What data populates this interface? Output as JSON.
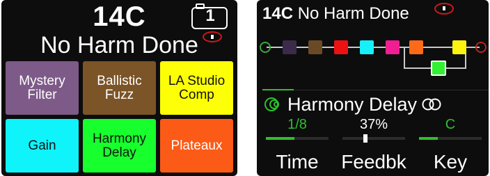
{
  "left_screen": {
    "preset_number": "14C",
    "preset_name": "No Harm Done",
    "snapshot_number": "1",
    "footswitches": [
      {
        "label": "Mystery\nFilter",
        "color": "#7d5a88",
        "text_color": "#ffffff"
      },
      {
        "label": "Ballistic\nFuzz",
        "color": "#7b5427",
        "text_color": "#ffffff"
      },
      {
        "label": "LA Studio\nComp",
        "color": "#fdff06",
        "text_color": "#111111"
      },
      {
        "label": "Gain",
        "color": "#0ff3fb",
        "text_color": "#111111"
      },
      {
        "label": "Harmony\nDelay",
        "color": "#17ff2c",
        "text_color": "#111111"
      },
      {
        "label": "Plateaux",
        "color": "#fb5a17",
        "text_color": "#ffffff"
      }
    ]
  },
  "right_screen": {
    "preset_number": "14C",
    "preset_name": "No Harm Done",
    "blocks": [
      {
        "name": "mystery-filter",
        "color": "#3c2a4a"
      },
      {
        "name": "ballistic-fuzz",
        "color": "#6a4a26"
      },
      {
        "name": "block-red",
        "color": "#ee1111"
      },
      {
        "name": "block-cyan",
        "color": "#16f0f8"
      },
      {
        "name": "block-magenta",
        "color": "#f01e92"
      },
      {
        "name": "block-orange",
        "color": "#ff6a18"
      },
      {
        "name": "block-yellow",
        "color": "#fbf20f"
      },
      {
        "name": "harmony-delay",
        "color": "#32f032",
        "selected": true
      }
    ],
    "input_color": "#3aa83a",
    "output_color": "#b82525",
    "selected_model": {
      "icon": "delay-icon",
      "name": "Harmony Delay",
      "stereo_icon": "stereo-icon"
    },
    "params": [
      {
        "value": "1/8",
        "label": "Time",
        "value_color": "#2ec02e",
        "fill": 0.45
      },
      {
        "value": "37%",
        "label": "Feedbk",
        "value_color": "#ffffff",
        "fill": 0.37
      },
      {
        "value": "C",
        "label": "Key",
        "value_color": "#2ec02e",
        "fill": 0.3
      }
    ],
    "accent_color": "#2ec02e"
  }
}
